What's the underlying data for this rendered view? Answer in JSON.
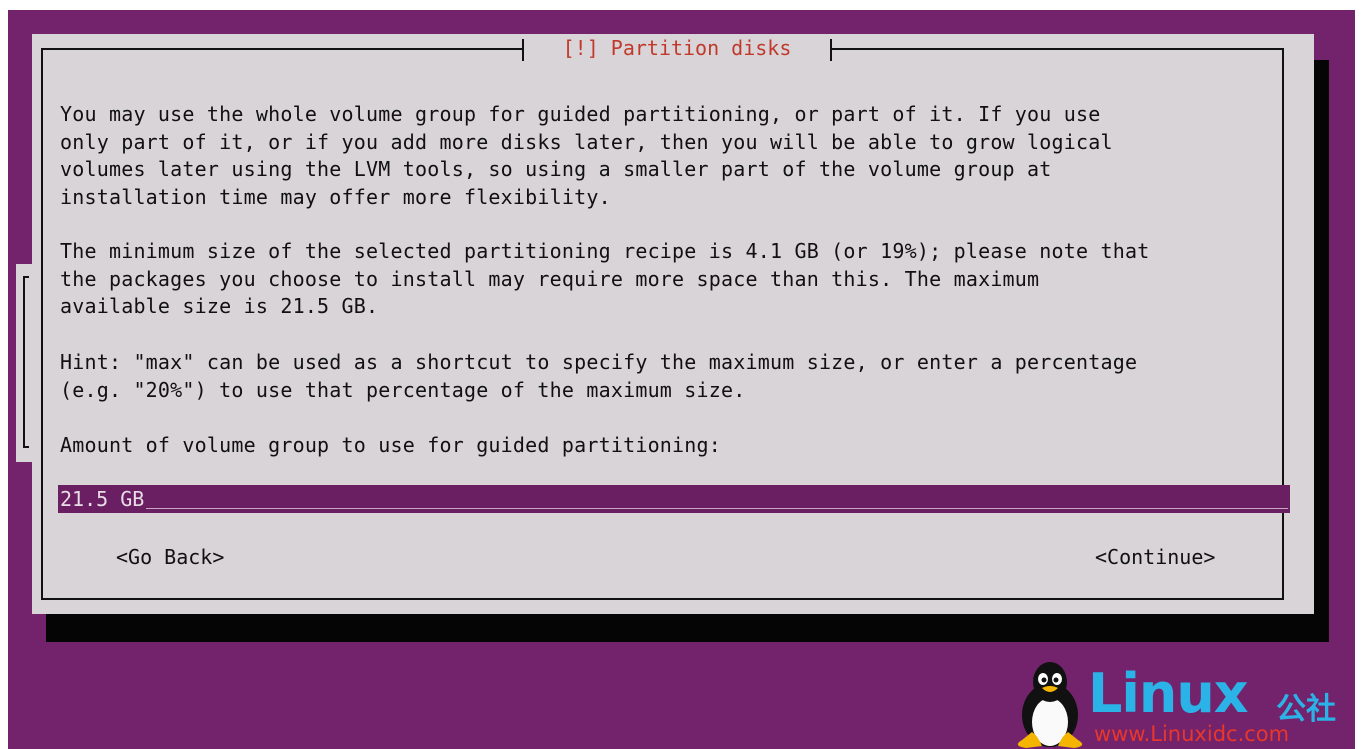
{
  "dialog": {
    "title": "[!] Partition disks",
    "paragraph1": "You may use the whole volume group for guided partitioning, or part of it. If you use\nonly part of it, or if you add more disks later, then you will be able to grow logical\nvolumes later using the LVM tools, so using a smaller part of the volume group at\ninstallation time may offer more flexibility.",
    "paragraph2": "The minimum size of the selected partitioning recipe is 4.1 GB (or 19%); please note that\nthe packages you choose to install may require more space than this. The maximum\navailable size is 21.5 GB.",
    "paragraph3": "Hint: \"max\" can be used as a shortcut to specify the maximum size, or enter a percentage\n(e.g. \"20%\") to use that percentage of the maximum size.",
    "prompt": "Amount of volume group to use for guided partitioning:",
    "input_value": "21.5 GB",
    "go_back_label": "<Go Back>",
    "continue_label": "<Continue>"
  },
  "watermark": {
    "brand": "Linux",
    "brand_cn": "公社",
    "url": "www.Linuxidc.com",
    "icon": "tux-penguin-icon"
  },
  "colors": {
    "background": "#72236b",
    "dialog": "#d9d4d8",
    "title": "#c0392b",
    "input_background": "#6a1f63",
    "watermark_blue": "#2bb3e8",
    "watermark_red": "#e8372a"
  }
}
